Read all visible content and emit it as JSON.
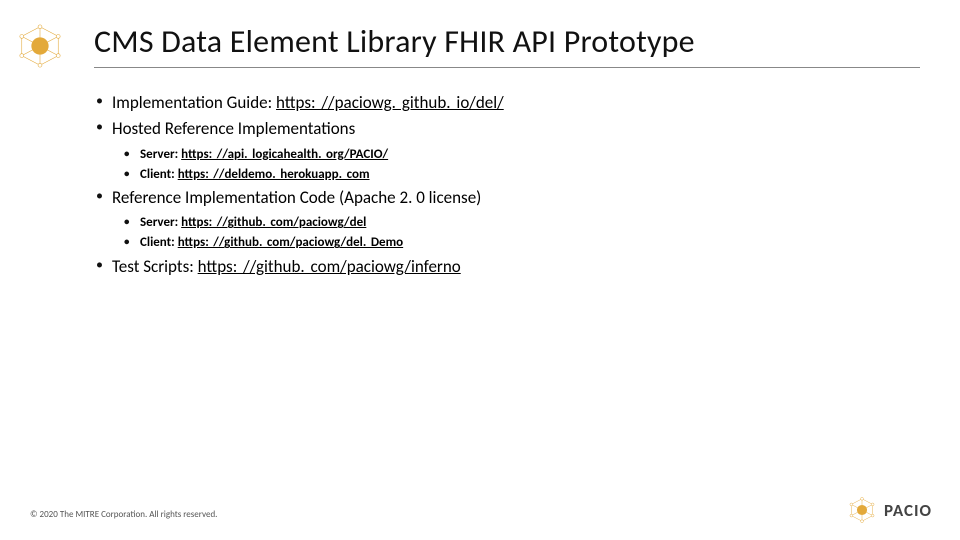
{
  "title": "CMS Data Element Library FHIR API Prototype",
  "brand": "PACIO",
  "footer": "© 2020 The MITRE Corporation. All rights reserved.",
  "bullets": [
    {
      "label": "Implementation Guide: ",
      "link": "https: //paciowg. github. io/del/"
    },
    {
      "label": "Hosted Reference Implementations",
      "children": [
        {
          "label": "Server: ",
          "link": "https: //api. logicahealth. org/PACIO/"
        },
        {
          "label": "Client: ",
          "link": "https: //deldemo. herokuapp. com"
        }
      ]
    },
    {
      "label": "Reference Implementation Code (Apache 2. 0 license)",
      "children": [
        {
          "label": "Server: ",
          "link": "https: //github. com/paciowg/del"
        },
        {
          "label": "Client: ",
          "link": "https: //github. com/paciowg/del. Demo"
        }
      ]
    },
    {
      "label": "Test Scripts: ",
      "link": "https: //github. com/paciowg/inferno"
    }
  ]
}
